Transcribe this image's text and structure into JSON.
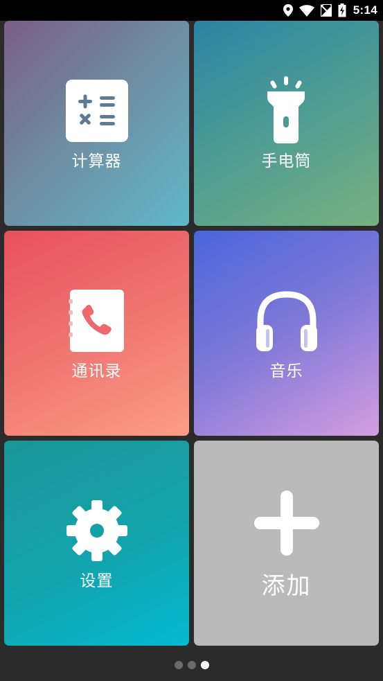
{
  "status_bar": {
    "time": "5:14",
    "icons": [
      "location-icon",
      "wifi-icon",
      "no-sim-icon",
      "battery-charging-icon"
    ]
  },
  "tiles": [
    {
      "label": "计算器",
      "icon": "calculator-icon"
    },
    {
      "label": "手电筒",
      "icon": "flashlight-icon"
    },
    {
      "label": "通讯录",
      "icon": "contacts-icon"
    },
    {
      "label": "音乐",
      "icon": "headphones-icon"
    },
    {
      "label": "设置",
      "icon": "gear-icon"
    },
    {
      "label": "添加",
      "icon": "plus-icon"
    }
  ],
  "pager": {
    "page_count": 3,
    "active_page": 3
  },
  "colors": {
    "calculator_tile": "#6e8fa4",
    "flashlight_tile": "#4b9a94",
    "contacts_tile": "#ef7571",
    "music_tile": "#8179d8",
    "settings_tile": "#13a4ad",
    "add_tile": "#bababa",
    "background": "#2b2b2b"
  }
}
